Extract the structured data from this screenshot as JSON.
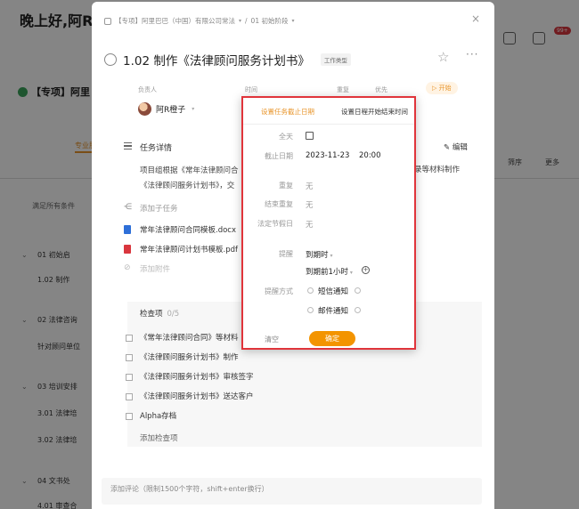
{
  "background": {
    "greeting": "晚上好,阿R",
    "project_title": "【专项】阿里",
    "active_tab": "专业服",
    "filter_text": "满足所有条件",
    "rows": [
      {
        "arrow": "⌄",
        "text": "01 初始启"
      },
      {
        "arrow": "",
        "text": "1.02 制作"
      },
      {
        "arrow": "⌄",
        "text": "02 法律咨询"
      },
      {
        "arrow": "",
        "text": "针对顾问单位"
      },
      {
        "arrow": "⌄",
        "text": "03 培训安排"
      },
      {
        "arrow": "",
        "text": "3.01 法律培"
      },
      {
        "arrow": "",
        "text": "3.02 法律培"
      },
      {
        "arrow": "⌄",
        "text": "04 文书处"
      },
      {
        "arrow": "",
        "text": "4.01 审查合"
      }
    ],
    "right_labels": [
      "筛序",
      "更多"
    ],
    "badge": "99+"
  },
  "modal": {
    "breadcrumb": [
      "【专项】阿里巴巴（中国）有限公司常法",
      "/",
      "01 初始阶段"
    ],
    "close": "×",
    "title": "1.02 制作《法律顾问服务计划书》",
    "type_tag": "工作类型",
    "star": "☆",
    "more": "···",
    "field_headers": [
      "负责人",
      "时间",
      "重复",
      "优先"
    ],
    "start_button": "▷ 开始",
    "owner": "阿R橙子",
    "task_detail_label": "任务详情",
    "edit": "✎ 编辑",
    "description_lines": [
      "项目组根据《常年法律顾问合",
      "《法律顾问服务计划书》，交"
    ],
    "description_right": "录等材料制作",
    "add_subtask": "添加子任务",
    "attachments": [
      {
        "type": "word",
        "name": "常年法律顾问合同模板.docx"
      },
      {
        "type": "pdf",
        "name": "常年法律顾问计划书模板.pdf"
      }
    ],
    "faded_item": "添加附件",
    "checklist": {
      "title": "检查项",
      "count": "0/5",
      "items": [
        "《常年法律顾问合同》等材料",
        "《法律顾问服务计划书》制作",
        "《法律顾问服务计划书》审核签字",
        "《法律顾问服务计划书》送达客户",
        "Alpha存档"
      ],
      "add": "添加检查项"
    },
    "comment_placeholder": "添加评论（限制1500个字符，shift+enter换行）"
  },
  "datepicker": {
    "tabs": [
      "设置任务截止日期",
      "设置日程开始结束时间"
    ],
    "all_day_label": "全天",
    "deadline_label": "截止日期",
    "deadline_date": "2023-11-23",
    "deadline_time": "20:00",
    "repeat_label": "重复",
    "repeat_value": "无",
    "end_repeat_label": "结束重复",
    "end_repeat_value": "无",
    "holiday_label": "法定节假日",
    "holiday_value": "无",
    "reminder_label": "提醒",
    "reminder_options": [
      "到期时",
      "到期前1小时"
    ],
    "remind_method_label": "提醒方式",
    "remind_methods": [
      "短信通知",
      "邮件通知"
    ],
    "clear": "清空",
    "confirm": "确定",
    "accent_color": "#f39400",
    "highlight_border_color": "#e0343b"
  }
}
